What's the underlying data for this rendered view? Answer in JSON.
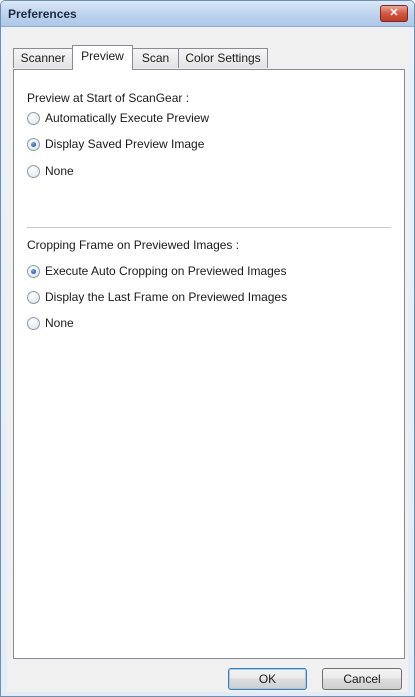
{
  "window": {
    "title": "Preferences",
    "close_glyph": "✕"
  },
  "tabs": [
    {
      "label": "Scanner",
      "active": false
    },
    {
      "label": "Preview",
      "active": true
    },
    {
      "label": "Scan",
      "active": false
    },
    {
      "label": "Color Settings",
      "active": false
    }
  ],
  "preview_start": {
    "label": "Preview at Start of ScanGear :",
    "options": [
      {
        "label": "Automatically Execute Preview",
        "selected": false
      },
      {
        "label": "Display Saved Preview Image",
        "selected": true
      },
      {
        "label": "None",
        "selected": false
      }
    ]
  },
  "cropping": {
    "label": "Cropping Frame on Previewed Images :",
    "options": [
      {
        "label": "Execute Auto Cropping on Previewed Images",
        "selected": true
      },
      {
        "label": "Display the Last Frame on Previewed Images",
        "selected": false
      },
      {
        "label": "None",
        "selected": false
      }
    ]
  },
  "buttons": {
    "ok": "OK",
    "cancel": "Cancel"
  },
  "colors": {
    "radio_selected": "#1f5fae",
    "close_button": "#c03b24"
  }
}
